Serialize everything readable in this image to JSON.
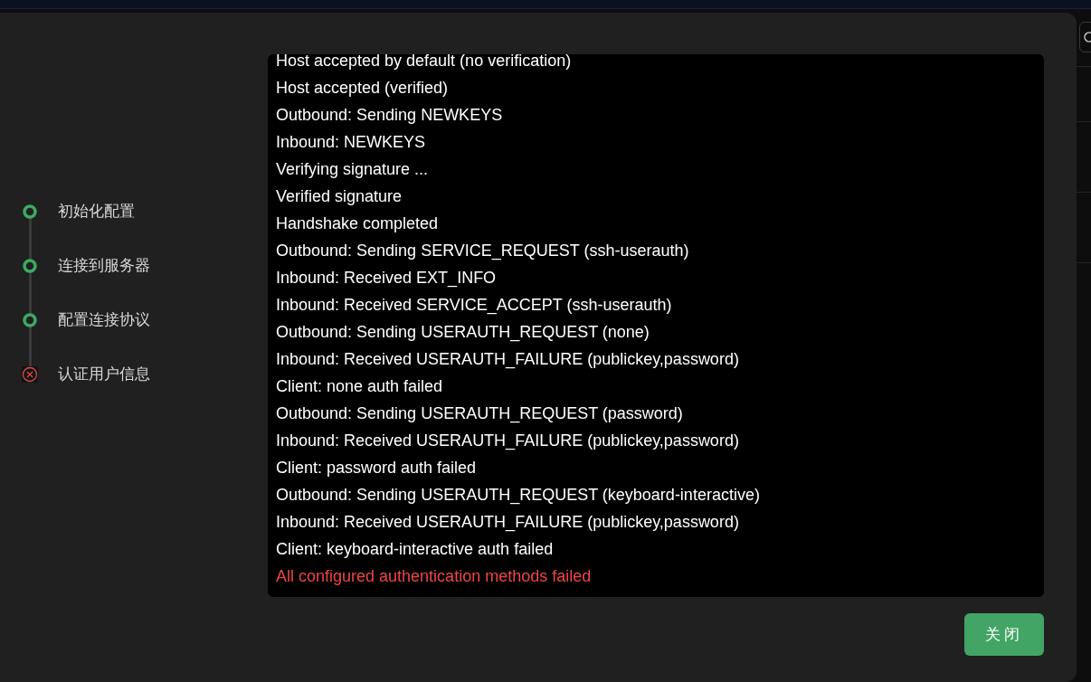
{
  "steps": [
    {
      "label": "初始化配置",
      "kind": "done"
    },
    {
      "label": "连接到服务器",
      "kind": "done"
    },
    {
      "label": "配置连接协议",
      "kind": "done"
    },
    {
      "label": "认证用户信息",
      "kind": "failed"
    }
  ],
  "log": [
    {
      "text": "Host accepted by default (no verification)",
      "kind": "info"
    },
    {
      "text": "Host accepted (verified)",
      "kind": "info"
    },
    {
      "text": "Outbound: Sending NEWKEYS",
      "kind": "info"
    },
    {
      "text": "Inbound: NEWKEYS",
      "kind": "info"
    },
    {
      "text": "Verifying signature ...",
      "kind": "info"
    },
    {
      "text": "Verified signature",
      "kind": "info"
    },
    {
      "text": "Handshake completed",
      "kind": "info"
    },
    {
      "text": "Outbound: Sending SERVICE_REQUEST (ssh-userauth)",
      "kind": "info"
    },
    {
      "text": "Inbound: Received EXT_INFO",
      "kind": "info"
    },
    {
      "text": "Inbound: Received SERVICE_ACCEPT (ssh-userauth)",
      "kind": "info"
    },
    {
      "text": "Outbound: Sending USERAUTH_REQUEST (none)",
      "kind": "info"
    },
    {
      "text": "Inbound: Received USERAUTH_FAILURE (publickey,password)",
      "kind": "info"
    },
    {
      "text": "Client: none auth failed",
      "kind": "info"
    },
    {
      "text": "Outbound: Sending USERAUTH_REQUEST (password)",
      "kind": "info"
    },
    {
      "text": "Inbound: Received USERAUTH_FAILURE (publickey,password)",
      "kind": "info"
    },
    {
      "text": "Client: password auth failed",
      "kind": "info"
    },
    {
      "text": "Outbound: Sending USERAUTH_REQUEST (keyboard-interactive)",
      "kind": "info"
    },
    {
      "text": "Inbound: Received USERAUTH_FAILURE (publickey,password)",
      "kind": "info"
    },
    {
      "text": "Client: keyboard-interactive auth failed",
      "kind": "info"
    },
    {
      "text": "All configured authentication methods failed",
      "kind": "error"
    }
  ],
  "close_button": "关闭"
}
